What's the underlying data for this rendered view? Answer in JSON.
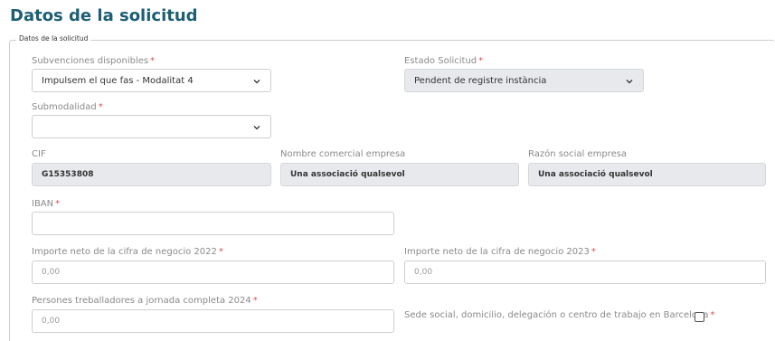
{
  "page": {
    "title": "Datos de la solicitud",
    "legend": "Datos de la solicitud"
  },
  "fields": {
    "subvenciones": {
      "label": "Subvenciones disponibles",
      "required": "*",
      "value": "Impulsem el que fas - Modalitat 4"
    },
    "estado": {
      "label": "Estado Solicitud",
      "required": "*",
      "value": "Pendent de registre instància"
    },
    "submodalidad": {
      "label": "Submodalidad",
      "required": "*",
      "value": ""
    },
    "cif": {
      "label": "CIF",
      "value": "G15353808"
    },
    "nombre_comercial": {
      "label": "Nombre comercial empresa",
      "value": "Una associació qualsevol"
    },
    "razon_social": {
      "label": "Razón social empresa",
      "value": "Una associació qualsevol"
    },
    "iban": {
      "label": "IBAN",
      "required": "*",
      "value": ""
    },
    "importe_2022": {
      "label": "Importe neto de la cifra de negocio 2022",
      "required": "*",
      "placeholder": "0,00"
    },
    "importe_2023": {
      "label": "Importe neto de la cifra de negocio 2023",
      "required": "*",
      "placeholder": "0,00"
    },
    "persones": {
      "label": "Persones treballadores a jornada completa 2024",
      "required": "*",
      "placeholder": "0,00"
    },
    "sede": {
      "label": "Sede social, domicilio, delegación o centro de trabajo en Barcelona",
      "required": "*",
      "checked": false
    }
  },
  "icons": {
    "dropdown": "chevron-down-icon"
  },
  "colors": {
    "title": "#1d5e74",
    "required": "#d9534f",
    "readonly_bg": "#e7e9ec"
  }
}
